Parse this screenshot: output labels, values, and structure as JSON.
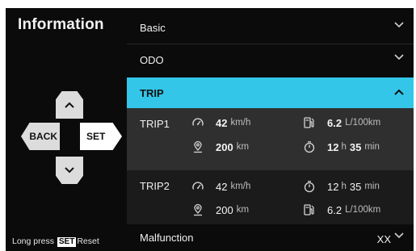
{
  "sidebar": {
    "title": "Information",
    "dpad": {
      "up_icon": "chevron-up-icon",
      "down_icon": "chevron-down-icon",
      "back_label": "BACK",
      "set_label": "SET"
    },
    "hint": {
      "prefix": "Long press",
      "key": "SET",
      "suffix": "Reset"
    }
  },
  "menu": {
    "basic": {
      "label": "Basic",
      "icon": "chevron-down-icon"
    },
    "odo": {
      "label": "ODO",
      "icon": "chevron-down-icon"
    },
    "trip": {
      "label": "TRIP",
      "icon": "chevron-up-icon",
      "expanded": true
    },
    "malfunction": {
      "label": "Malfunction",
      "value": "XX",
      "icon": "chevron-down-icon"
    }
  },
  "trips": [
    {
      "name": "TRIP1",
      "speed": {
        "icon": "speedometer-icon",
        "value": "42",
        "unit": "km/h"
      },
      "distance": {
        "icon": "location-pin-icon",
        "value": "200",
        "unit": "km"
      },
      "fuel": {
        "icon": "fuel-pump-icon",
        "value": "6.2",
        "unit": "L/100km"
      },
      "time": {
        "icon": "stopwatch-icon",
        "hours": "12",
        "hours_unit": "h",
        "minutes": "35",
        "minutes_unit": "min"
      }
    },
    {
      "name": "TRIP2",
      "speed": {
        "icon": "speedometer-icon",
        "value": "42",
        "unit": "km/h"
      },
      "distance": {
        "icon": "location-pin-icon",
        "value": "200",
        "unit": "km"
      },
      "time": {
        "icon": "stopwatch-icon",
        "hours": "12",
        "hours_unit": "h",
        "minutes": "35",
        "minutes_unit": "min"
      },
      "fuel": {
        "icon": "fuel-pump-icon",
        "value": "6.2",
        "unit": "L/100km"
      }
    }
  ],
  "colors": {
    "background": "#0b0b0b",
    "accent": "#33c6e8",
    "trip1_bg": "#2f2f2f",
    "trip2_bg": "#1b1b1b"
  }
}
